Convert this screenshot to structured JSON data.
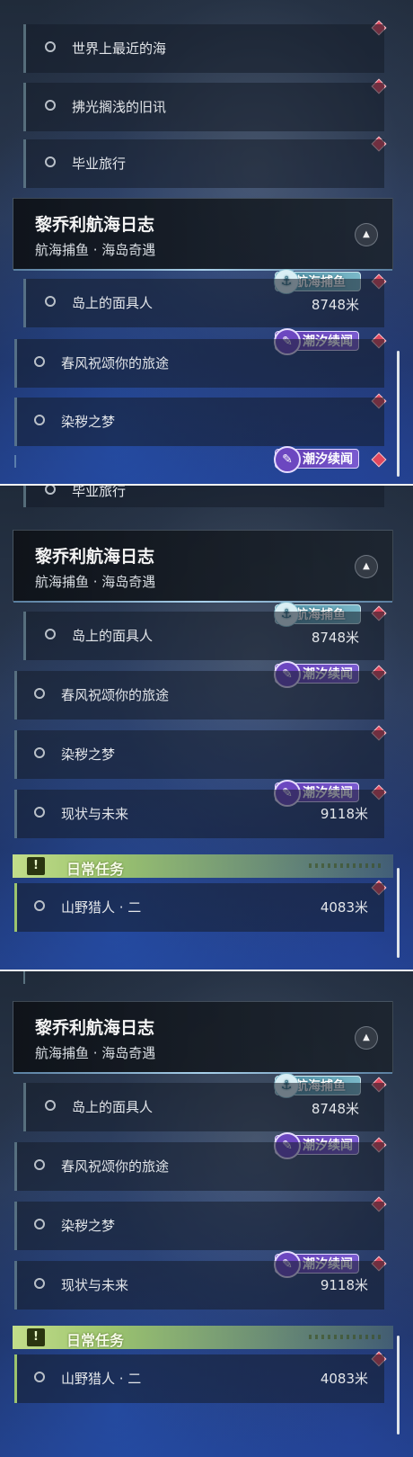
{
  "panels": [
    {
      "rows": [
        {
          "label": "世界上最近的海"
        },
        {
          "label": "拂光搁浅的旧讯"
        },
        {
          "label": "毕业旅行"
        }
      ],
      "header": {
        "title": "黎乔利航海日志",
        "subtitle": "航海捕鱼 · 海岛奇遇"
      },
      "sub_rows": [
        {
          "label": "岛上的面具人",
          "distance": "8748米",
          "badge": "航海捕鱼"
        },
        {
          "label": "春风祝颂你的旅途",
          "badge": "潮汐续闻"
        },
        {
          "label": "染秽之梦"
        },
        {
          "badge": "潮汐续闻"
        }
      ]
    },
    {
      "rows": [
        {
          "label": "毕业旅行"
        }
      ],
      "header": {
        "title": "黎乔利航海日志",
        "subtitle": "航海捕鱼 · 海岛奇遇"
      },
      "sub_rows": [
        {
          "label": "岛上的面具人",
          "distance": "8748米",
          "badge": "航海捕鱼"
        },
        {
          "label": "春风祝颂你的旅途",
          "badge": "潮汐续闻"
        },
        {
          "label": "染秽之梦"
        },
        {
          "label": "现状与未来",
          "distance": "9118米",
          "badge": "潮汐续闻"
        }
      ],
      "daily": {
        "title": "日常任务",
        "icon": "!",
        "items": [
          {
            "label": "山野猎人 · 二",
            "distance": "4083米"
          }
        ]
      }
    },
    {
      "header": {
        "title": "黎乔利航海日志",
        "subtitle": "航海捕鱼 · 海岛奇遇"
      },
      "sub_rows": [
        {
          "label": "岛上的面具人",
          "distance": "8748米",
          "badge": "航海捕鱼"
        },
        {
          "label": "春风祝颂你的旅途",
          "badge": "潮汐续闻"
        },
        {
          "label": "染秽之梦"
        },
        {
          "label": "现状与未来",
          "distance": "9118米",
          "badge": "潮汐续闻"
        }
      ],
      "daily": {
        "title": "日常任务",
        "icon": "!",
        "items": [
          {
            "label": "山野猎人 · 二",
            "distance": "4083米"
          }
        ]
      }
    }
  ],
  "icons": {
    "quest_status": "circle-outline-icon",
    "tracking": "red-diamond-icon",
    "collapse": "triangle-up-icon",
    "fish_badge": "fish-hook-icon",
    "tide_badge": "tide-wave-icon",
    "daily": "exclamation-icon"
  },
  "colors": {
    "tracking_marker": "#e1485e",
    "daily_accent": "#9cc46e",
    "tide_badge": "#6a48c2",
    "fish_badge": "#6aa8bd"
  }
}
